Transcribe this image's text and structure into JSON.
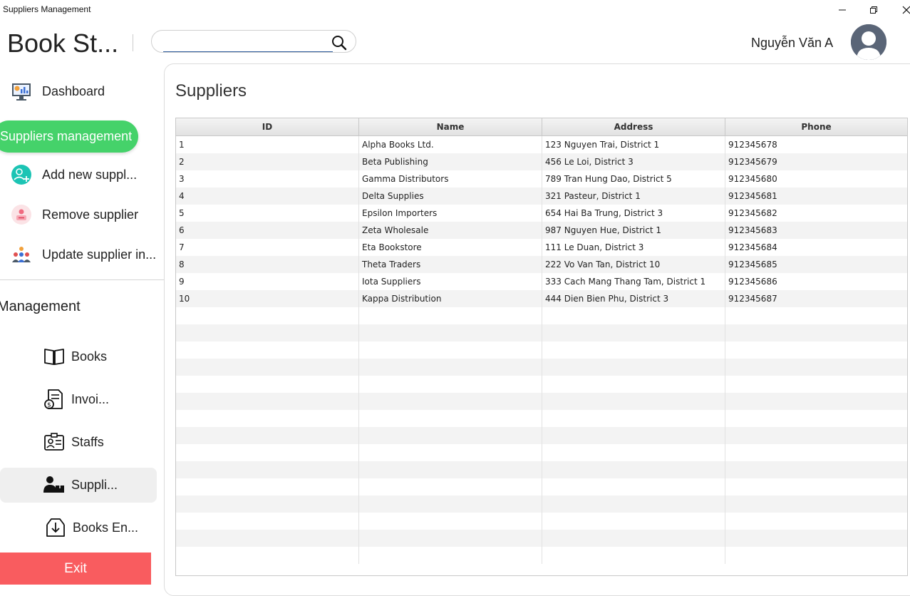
{
  "window": {
    "title": "Suppliers Management"
  },
  "header": {
    "brand": "Book St...",
    "search": {
      "value": "",
      "placeholder": ""
    },
    "username": "Nguyễn Văn A"
  },
  "sidebar": {
    "dashboard": "Dashboard",
    "active": "Suppliers management",
    "actions": [
      "Add new suppl...",
      "Remove supplier",
      "Update supplier in..."
    ],
    "management_heading": "Management",
    "nav": [
      "Books",
      "Invoi...",
      "Staffs",
      "Suppli...",
      "Books En..."
    ],
    "exit": "Exit"
  },
  "main": {
    "title": "Suppliers",
    "table": {
      "columns": [
        "ID",
        "Name",
        "Address",
        "Phone"
      ],
      "rows": [
        [
          "1",
          "Alpha Books Ltd.",
          "123 Nguyen Trai, District 1",
          "912345678"
        ],
        [
          "2",
          "Beta Publishing",
          "456 Le Loi, District 3",
          "912345679"
        ],
        [
          "3",
          "Gamma Distributors",
          "789 Tran Hung Dao, District 5",
          "912345680"
        ],
        [
          "4",
          "Delta Supplies",
          "321 Pasteur, District 1",
          "912345681"
        ],
        [
          "5",
          "Epsilon Importers",
          "654 Hai Ba Trung, District 3",
          "912345682"
        ],
        [
          "6",
          "Zeta Wholesale",
          "987 Nguyen Hue, District 1",
          "912345683"
        ],
        [
          "7",
          "Eta Bookstore",
          "111 Le Duan, District 3",
          "912345684"
        ],
        [
          "8",
          "Theta Traders",
          "222 Vo Van Tan, District 10",
          "912345685"
        ],
        [
          "9",
          "Iota Suppliers",
          "333 Cach Mang Thang Tam, District 1",
          "912345686"
        ],
        [
          "10",
          "Kappa Distribution",
          "444 Dien Bien Phu, District 3",
          "912345687"
        ]
      ]
    }
  },
  "colors": {
    "accent_green": "#45d26a",
    "exit_red": "#f95c5f",
    "selected_nav": "#efefef"
  }
}
